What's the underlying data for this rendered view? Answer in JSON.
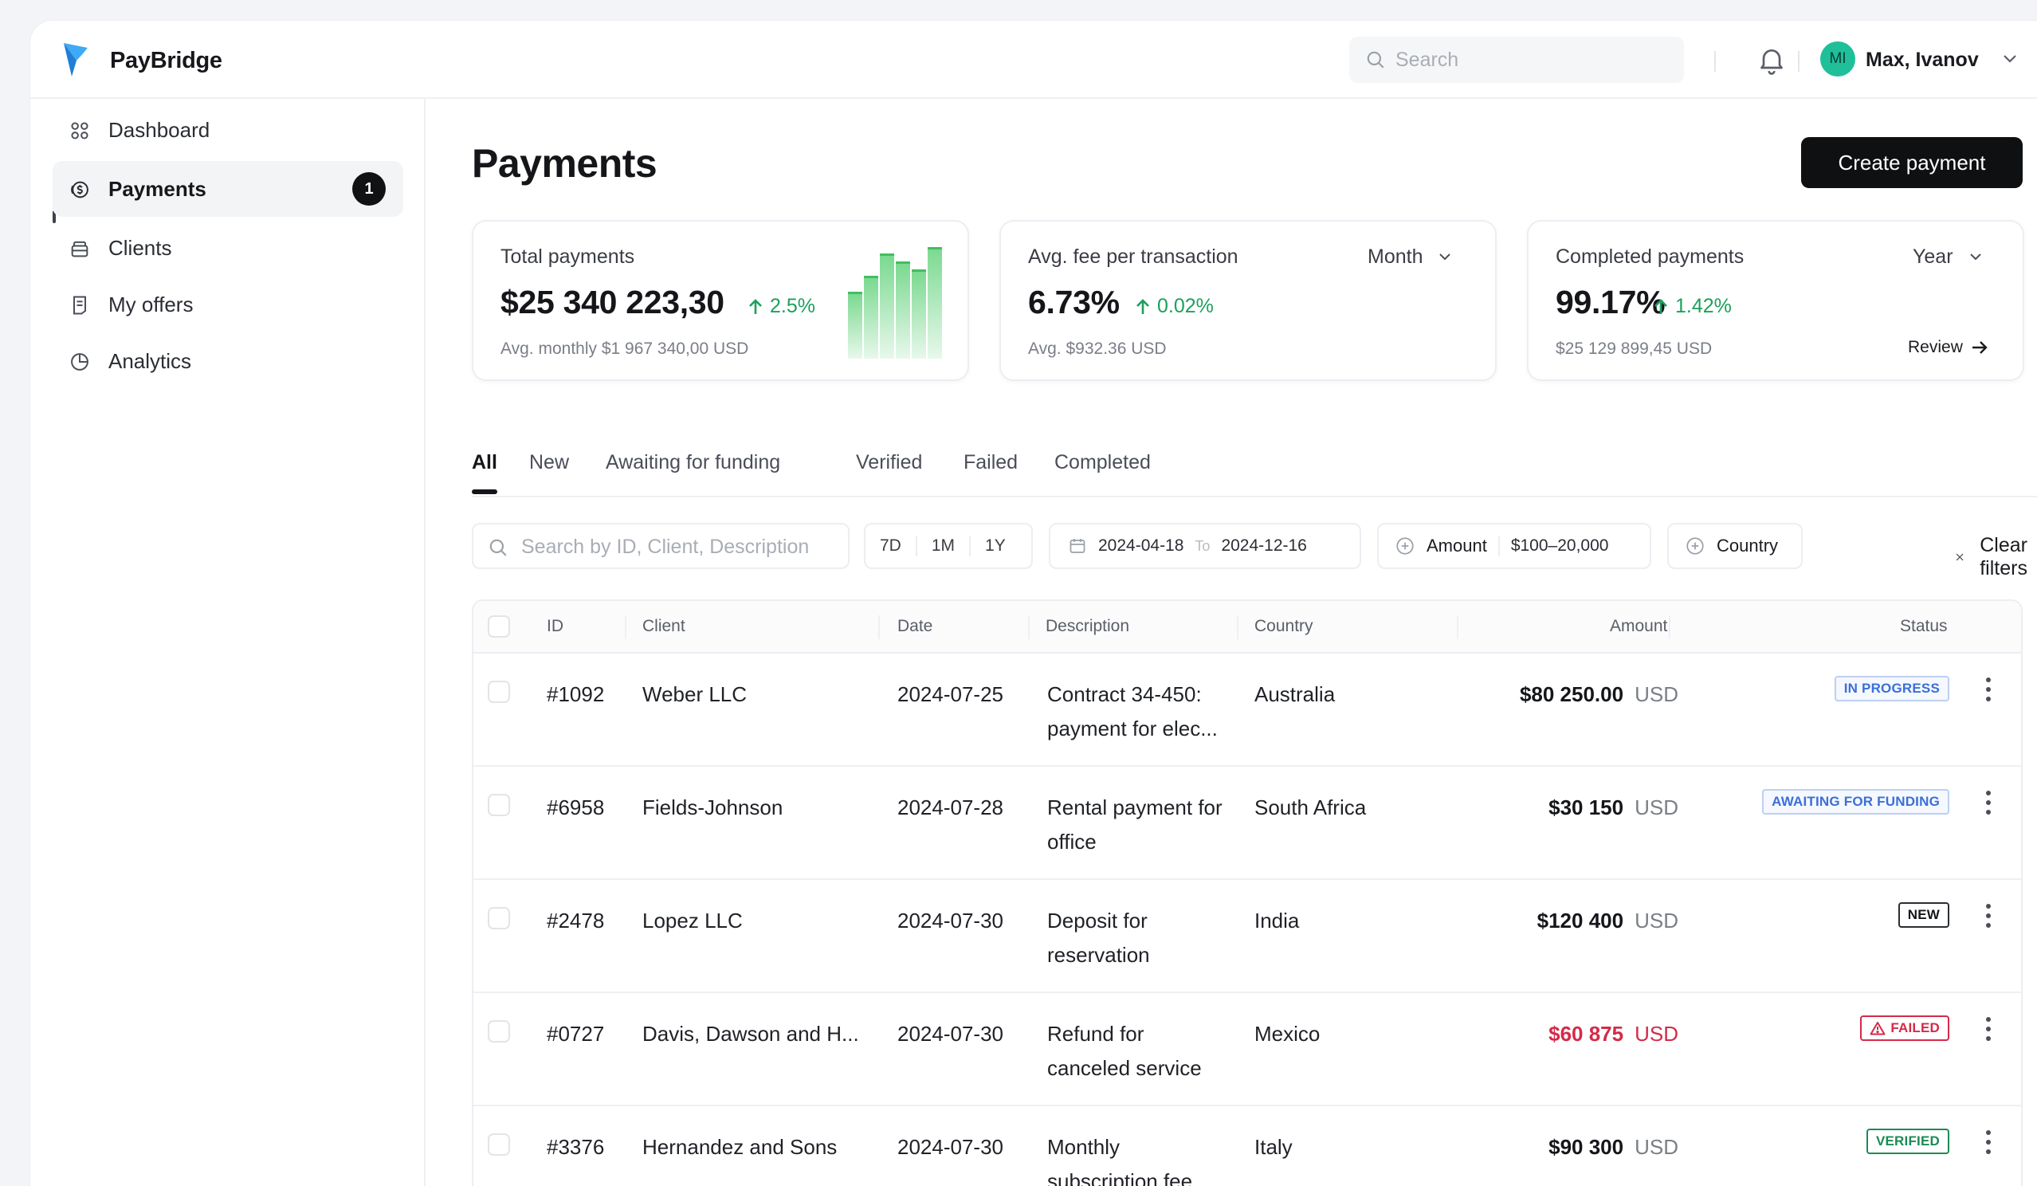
{
  "app": {
    "brand": "PayBridge"
  },
  "header": {
    "search_placeholder": "Search",
    "user": {
      "initials": "MI",
      "name": "Max, Ivanov"
    }
  },
  "sidebar": {
    "items": [
      {
        "label": "Dashboard",
        "icon": "dashboard-icon"
      },
      {
        "label": "Payments",
        "icon": "payments-icon",
        "badge": "1",
        "active": true
      },
      {
        "label": "Clients",
        "icon": "clients-icon"
      },
      {
        "label": "My offers",
        "icon": "offers-icon"
      },
      {
        "label": "Analytics",
        "icon": "analytics-icon"
      }
    ]
  },
  "page": {
    "title": "Payments",
    "create_button": "Create payment"
  },
  "cards": {
    "total": {
      "label": "Total payments",
      "value": "$25 340 223,30",
      "delta": "2.5%",
      "sub": "Avg. monthly $1 967 340,00 USD"
    },
    "fee": {
      "label": "Avg. fee per transaction",
      "value": "6.73%",
      "delta": "0.02%",
      "sub": "Avg. $932.36 USD",
      "period": "Month"
    },
    "completed": {
      "label": "Completed payments",
      "value": "99.17%",
      "delta": "1.42%",
      "sub": "$25 129 899,45 USD",
      "period": "Year",
      "link": "Review"
    }
  },
  "tabs": [
    {
      "label": "All",
      "active": true
    },
    {
      "label": "New"
    },
    {
      "label": "Awaiting for funding"
    },
    {
      "label": "Verified"
    },
    {
      "label": "Failed"
    },
    {
      "label": "Completed"
    }
  ],
  "filters": {
    "search_placeholder": "Search by ID, Client, Description",
    "ranges": [
      "7D",
      "1M",
      "1Y"
    ],
    "date_from": "2024-04-18",
    "date_to_label": "To",
    "date_to": "2024-12-16",
    "amount_label": "Amount",
    "amount_value": "$100–20,000",
    "country_label": "Country",
    "clear_label": "Clear filters"
  },
  "table": {
    "columns": [
      "ID",
      "Client",
      "Date",
      "Description",
      "Country",
      "Amount",
      "Status"
    ],
    "rows": [
      {
        "id": "#1092",
        "client": "Weber LLC",
        "date": "2024-07-25",
        "description": "Contract 34-450: payment for elec...",
        "country": "Australia",
        "amount": "$80 250.00",
        "currency": "USD",
        "status": "IN PROGRESS",
        "status_type": "progress"
      },
      {
        "id": "#6958",
        "client": "Fields-Johnson",
        "date": "2024-07-28",
        "description": "Rental payment for office",
        "country": "South Africa",
        "amount": "$30 150",
        "currency": "USD",
        "status": "AWAITING FOR FUNDING",
        "status_type": "awaiting"
      },
      {
        "id": "#2478",
        "client": "Lopez LLC",
        "date": "2024-07-30",
        "description": "Deposit for reservation",
        "country": "India",
        "amount": "$120 400",
        "currency": "USD",
        "status": "NEW",
        "status_type": "new"
      },
      {
        "id": "#0727",
        "client": "Davis, Dawson and H...",
        "date": "2024-07-30",
        "description": "Refund for canceled service",
        "country": "Mexico",
        "amount": "$60 875",
        "currency": "USD",
        "status": "FAILED",
        "status_type": "failed",
        "negative": true
      },
      {
        "id": "#3376",
        "client": "Hernandez and Sons",
        "date": "2024-07-30",
        "description": "Monthly subscription fee",
        "country": "Italy",
        "amount": "$90 300",
        "currency": "USD",
        "status": "VERIFIED",
        "status_type": "verified"
      }
    ]
  },
  "colors": {
    "accent": "#0f1012",
    "positive": "#1ca05c",
    "negative": "#d42a48",
    "info": "#3a6fd8",
    "avatar": "#1fbf9a"
  }
}
